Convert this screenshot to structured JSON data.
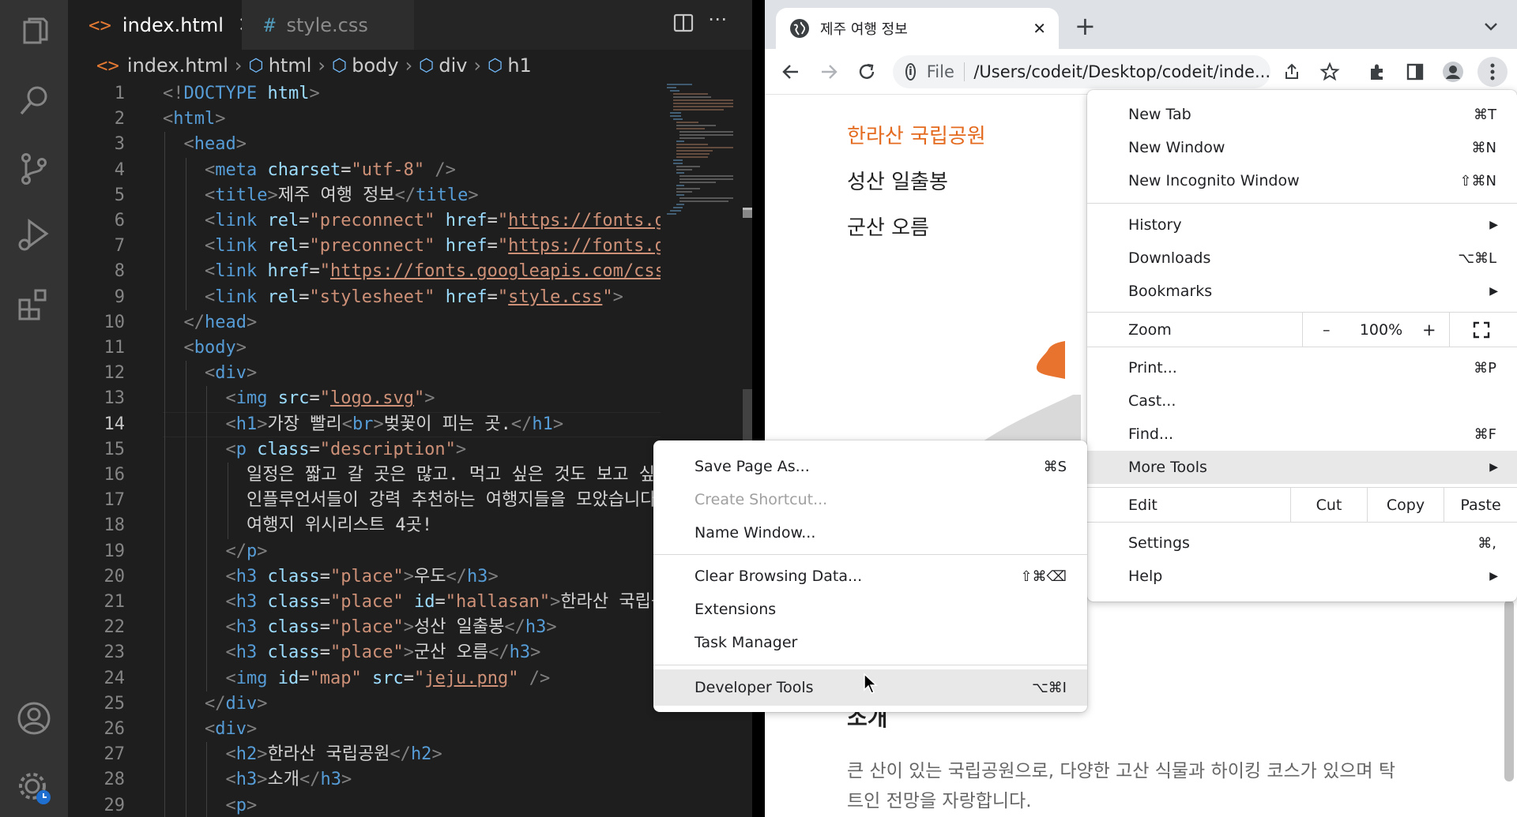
{
  "vscode": {
    "tabs": [
      {
        "label": "index.html",
        "icon": "html-file-icon",
        "active": true
      },
      {
        "label": "style.css",
        "icon": "css-file-icon",
        "active": false
      }
    ],
    "breadcrumb": [
      "index.html",
      "html",
      "body",
      "div",
      "h1"
    ],
    "current_line": 14,
    "lines": [
      {
        "n": "1",
        "indent": 0,
        "tokens": [
          [
            "p",
            "<!"
          ],
          [
            "t",
            "DOCTYPE"
          ],
          [
            "x",
            " "
          ],
          [
            "a",
            "html"
          ],
          [
            "p",
            ">"
          ]
        ]
      },
      {
        "n": "2",
        "indent": 0,
        "tokens": [
          [
            "p",
            "<"
          ],
          [
            "t",
            "html"
          ],
          [
            "p",
            ">"
          ]
        ]
      },
      {
        "n": "3",
        "indent": 1,
        "tokens": [
          [
            "p",
            "<"
          ],
          [
            "t",
            "head"
          ],
          [
            "p",
            ">"
          ]
        ]
      },
      {
        "n": "4",
        "indent": 2,
        "tokens": [
          [
            "p",
            "<"
          ],
          [
            "t",
            "meta"
          ],
          [
            "x",
            " "
          ],
          [
            "a",
            "charset"
          ],
          [
            "x",
            "="
          ],
          [
            "s",
            "\"utf-8\""
          ],
          [
            "x",
            " "
          ],
          [
            "p",
            "/>"
          ]
        ]
      },
      {
        "n": "5",
        "indent": 2,
        "tokens": [
          [
            "p",
            "<"
          ],
          [
            "t",
            "title"
          ],
          [
            "p",
            ">"
          ],
          [
            "x",
            "제주 여행 정보"
          ],
          [
            "p",
            "</"
          ],
          [
            "t",
            "title"
          ],
          [
            "p",
            ">"
          ]
        ]
      },
      {
        "n": "6",
        "indent": 2,
        "tokens": [
          [
            "p",
            "<"
          ],
          [
            "t",
            "link"
          ],
          [
            "x",
            " "
          ],
          [
            "a",
            "rel"
          ],
          [
            "x",
            "="
          ],
          [
            "s",
            "\"preconnect\""
          ],
          [
            "x",
            " "
          ],
          [
            "a",
            "href"
          ],
          [
            "x",
            "="
          ],
          [
            "s",
            "\""
          ],
          [
            "u",
            "https://fonts.go"
          ]
        ]
      },
      {
        "n": "7",
        "indent": 2,
        "tokens": [
          [
            "p",
            "<"
          ],
          [
            "t",
            "link"
          ],
          [
            "x",
            " "
          ],
          [
            "a",
            "rel"
          ],
          [
            "x",
            "="
          ],
          [
            "s",
            "\"preconnect\""
          ],
          [
            "x",
            " "
          ],
          [
            "a",
            "href"
          ],
          [
            "x",
            "="
          ],
          [
            "s",
            "\""
          ],
          [
            "u",
            "https://fonts.gs"
          ]
        ]
      },
      {
        "n": "8",
        "indent": 2,
        "tokens": [
          [
            "p",
            "<"
          ],
          [
            "t",
            "link"
          ],
          [
            "x",
            " "
          ],
          [
            "a",
            "href"
          ],
          [
            "x",
            "="
          ],
          [
            "s",
            "\""
          ],
          [
            "u",
            "https://fonts.googleapis.com/css2"
          ]
        ]
      },
      {
        "n": "9",
        "indent": 2,
        "tokens": [
          [
            "p",
            "<"
          ],
          [
            "t",
            "link"
          ],
          [
            "x",
            " "
          ],
          [
            "a",
            "rel"
          ],
          [
            "x",
            "="
          ],
          [
            "s",
            "\"stylesheet\""
          ],
          [
            "x",
            " "
          ],
          [
            "a",
            "href"
          ],
          [
            "x",
            "="
          ],
          [
            "s",
            "\""
          ],
          [
            "u",
            "style.css"
          ],
          [
            "s",
            "\""
          ],
          [
            "p",
            ">"
          ]
        ]
      },
      {
        "n": "10",
        "indent": 1,
        "tokens": [
          [
            "p",
            "</"
          ],
          [
            "t",
            "head"
          ],
          [
            "p",
            ">"
          ]
        ]
      },
      {
        "n": "11",
        "indent": 1,
        "tokens": [
          [
            "p",
            "<"
          ],
          [
            "t",
            "body"
          ],
          [
            "p",
            ">"
          ]
        ]
      },
      {
        "n": "12",
        "indent": 2,
        "tokens": [
          [
            "p",
            "<"
          ],
          [
            "t",
            "div"
          ],
          [
            "p",
            ">"
          ]
        ]
      },
      {
        "n": "13",
        "indent": 3,
        "tokens": [
          [
            "p",
            "<"
          ],
          [
            "t",
            "img"
          ],
          [
            "x",
            " "
          ],
          [
            "a",
            "src"
          ],
          [
            "x",
            "="
          ],
          [
            "s",
            "\""
          ],
          [
            "u",
            "logo.svg"
          ],
          [
            "s",
            "\""
          ],
          [
            "p",
            ">"
          ]
        ]
      },
      {
        "n": "14",
        "indent": 3,
        "tokens": [
          [
            "p",
            "<"
          ],
          [
            "t",
            "h1"
          ],
          [
            "p",
            ">"
          ],
          [
            "x",
            "가장 빨리"
          ],
          [
            "p",
            "<"
          ],
          [
            "t",
            "br"
          ],
          [
            "p",
            ">"
          ],
          [
            "x",
            "벚꽃이 피는 곳."
          ],
          [
            "p",
            "</"
          ],
          [
            "t",
            "h1"
          ],
          [
            "p",
            ">"
          ]
        ]
      },
      {
        "n": "15",
        "indent": 3,
        "tokens": [
          [
            "p",
            "<"
          ],
          [
            "t",
            "p"
          ],
          [
            "x",
            " "
          ],
          [
            "a",
            "class"
          ],
          [
            "x",
            "="
          ],
          [
            "s",
            "\"description\""
          ],
          [
            "p",
            ">"
          ]
        ]
      },
      {
        "n": "16",
        "indent": 4,
        "tokens": [
          [
            "x",
            "일정은 짧고 갈 곳은 많고. 먹고 싶은 것도 보고 싶은"
          ]
        ]
      },
      {
        "n": "17",
        "indent": 4,
        "tokens": [
          [
            "x",
            "인플루언서들이 강력 추천하는 여행지들을 모았습니다. 한"
          ]
        ]
      },
      {
        "n": "18",
        "indent": 4,
        "tokens": [
          [
            "x",
            "여행지 위시리스트 4곳!"
          ]
        ]
      },
      {
        "n": "19",
        "indent": 3,
        "tokens": [
          [
            "p",
            "</"
          ],
          [
            "t",
            "p"
          ],
          [
            "p",
            ">"
          ]
        ]
      },
      {
        "n": "20",
        "indent": 3,
        "tokens": [
          [
            "p",
            "<"
          ],
          [
            "t",
            "h3"
          ],
          [
            "x",
            " "
          ],
          [
            "a",
            "class"
          ],
          [
            "x",
            "="
          ],
          [
            "s",
            "\"place\""
          ],
          [
            "p",
            ">"
          ],
          [
            "x",
            "우도"
          ],
          [
            "p",
            "</"
          ],
          [
            "t",
            "h3"
          ],
          [
            "p",
            ">"
          ]
        ]
      },
      {
        "n": "21",
        "indent": 3,
        "tokens": [
          [
            "p",
            "<"
          ],
          [
            "t",
            "h3"
          ],
          [
            "x",
            " "
          ],
          [
            "a",
            "class"
          ],
          [
            "x",
            "="
          ],
          [
            "s",
            "\"place\""
          ],
          [
            "x",
            " "
          ],
          [
            "a",
            "id"
          ],
          [
            "x",
            "="
          ],
          [
            "s",
            "\"hallasan\""
          ],
          [
            "p",
            ">"
          ],
          [
            "x",
            "한라산 국립공"
          ]
        ]
      },
      {
        "n": "22",
        "indent": 3,
        "tokens": [
          [
            "p",
            "<"
          ],
          [
            "t",
            "h3"
          ],
          [
            "x",
            " "
          ],
          [
            "a",
            "class"
          ],
          [
            "x",
            "="
          ],
          [
            "s",
            "\"place\""
          ],
          [
            "p",
            ">"
          ],
          [
            "x",
            "성산 일출봉"
          ],
          [
            "p",
            "</"
          ],
          [
            "t",
            "h3"
          ],
          [
            "p",
            ">"
          ]
        ]
      },
      {
        "n": "23",
        "indent": 3,
        "tokens": [
          [
            "p",
            "<"
          ],
          [
            "t",
            "h3"
          ],
          [
            "x",
            " "
          ],
          [
            "a",
            "class"
          ],
          [
            "x",
            "="
          ],
          [
            "s",
            "\"place\""
          ],
          [
            "p",
            ">"
          ],
          [
            "x",
            "군산 오름"
          ],
          [
            "p",
            "</"
          ],
          [
            "t",
            "h3"
          ],
          [
            "p",
            ">"
          ]
        ]
      },
      {
        "n": "24",
        "indent": 3,
        "tokens": [
          [
            "p",
            "<"
          ],
          [
            "t",
            "img"
          ],
          [
            "x",
            " "
          ],
          [
            "a",
            "id"
          ],
          [
            "x",
            "="
          ],
          [
            "s",
            "\"map\""
          ],
          [
            "x",
            " "
          ],
          [
            "a",
            "src"
          ],
          [
            "x",
            "="
          ],
          [
            "s",
            "\""
          ],
          [
            "u",
            "jeju.png"
          ],
          [
            "s",
            "\""
          ],
          [
            "x",
            " "
          ],
          [
            "p",
            "/>"
          ]
        ]
      },
      {
        "n": "25",
        "indent": 2,
        "tokens": [
          [
            "p",
            "</"
          ],
          [
            "t",
            "div"
          ],
          [
            "p",
            ">"
          ]
        ]
      },
      {
        "n": "26",
        "indent": 2,
        "tokens": [
          [
            "p",
            "<"
          ],
          [
            "t",
            "div"
          ],
          [
            "p",
            ">"
          ]
        ]
      },
      {
        "n": "27",
        "indent": 3,
        "tokens": [
          [
            "p",
            "<"
          ],
          [
            "t",
            "h2"
          ],
          [
            "p",
            ">"
          ],
          [
            "x",
            "한라산 국립공원"
          ],
          [
            "p",
            "</"
          ],
          [
            "t",
            "h2"
          ],
          [
            "p",
            ">"
          ]
        ]
      },
      {
        "n": "28",
        "indent": 3,
        "tokens": [
          [
            "p",
            "<"
          ],
          [
            "t",
            "h3"
          ],
          [
            "p",
            ">"
          ],
          [
            "x",
            "소개"
          ],
          [
            "p",
            "</"
          ],
          [
            "t",
            "h3"
          ],
          [
            "p",
            ">"
          ]
        ]
      },
      {
        "n": "29",
        "indent": 3,
        "tokens": [
          [
            "p",
            "<"
          ],
          [
            "t",
            "p"
          ],
          [
            "p",
            ">"
          ]
        ]
      }
    ],
    "activity_icons": [
      "explorer-icon",
      "search-icon",
      "source-control-icon",
      "run-debug-icon",
      "extensions-icon",
      "account-icon",
      "settings-gear-icon"
    ]
  },
  "chrome": {
    "tab_title": "제주 여행 정보",
    "address_scheme": "File",
    "address_url": "/Users/codeit/Desktop/codeit/inde...",
    "page": {
      "places": [
        "한라산 국립공원",
        "성산 일출봉",
        "군산 오름"
      ],
      "active_place_color": "#e36a1e",
      "section_heading": "소개",
      "description": "큰 산이 있는 국립공원으로, 다양한 고산 식물과 하이킹 코스가 있으며 탁 트인 전망을 자랑합니다.",
      "description_line1": "큰 산이 있는 국립공원으로, 다양한 고산 식물과 하이킹 코스가 있으며 탁",
      "description_line2": "트인 전망을 자랑합니다."
    },
    "main_menu": {
      "new_tab": {
        "label": "New Tab",
        "shortcut": "⌘T"
      },
      "new_window": {
        "label": "New Window",
        "shortcut": "⌘N"
      },
      "new_incognito": {
        "label": "New Incognito Window",
        "shortcut": "⇧⌘N"
      },
      "history": {
        "label": "History"
      },
      "downloads": {
        "label": "Downloads",
        "shortcut": "⌥⌘L"
      },
      "bookmarks": {
        "label": "Bookmarks"
      },
      "zoom": {
        "label": "Zoom",
        "minus": "–",
        "value": "100%",
        "plus": "+"
      },
      "print": {
        "label": "Print...",
        "shortcut": "⌘P"
      },
      "cast": {
        "label": "Cast..."
      },
      "find": {
        "label": "Find...",
        "shortcut": "⌘F"
      },
      "more_tools": {
        "label": "More Tools"
      },
      "edit": {
        "label": "Edit",
        "cut": "Cut",
        "copy": "Copy",
        "paste": "Paste"
      },
      "settings": {
        "label": "Settings",
        "shortcut": "⌘,"
      },
      "help": {
        "label": "Help"
      }
    },
    "more_tools_menu": {
      "save_page": {
        "label": "Save Page As...",
        "shortcut": "⌘S"
      },
      "create_shortcut": {
        "label": "Create Shortcut...",
        "disabled": true
      },
      "name_window": {
        "label": "Name Window..."
      },
      "clear_browsing": {
        "label": "Clear Browsing Data...",
        "shortcut": "⇧⌘⌫"
      },
      "extensions": {
        "label": "Extensions"
      },
      "task_manager": {
        "label": "Task Manager"
      },
      "developer_tools": {
        "label": "Developer Tools",
        "shortcut": "⌥⌘I"
      }
    }
  }
}
